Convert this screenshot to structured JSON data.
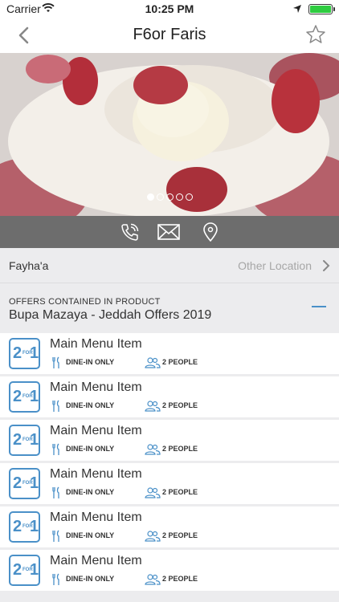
{
  "status_bar": {
    "carrier": "Carrier",
    "time": "10:25 PM"
  },
  "nav": {
    "title": "F6or Faris"
  },
  "carousel": {
    "count": 5,
    "active_index": 0
  },
  "location": {
    "branch": "Fayha'a",
    "other_label": "Other Location"
  },
  "offers": {
    "caption": "OFFERS CONTAINED IN PRODUCT",
    "group_name": "Bupa Mazaya - Jeddah Offers 2019",
    "items": [
      {
        "badge": "2for1",
        "title": "Main Menu Item",
        "dine": "DINE-IN ONLY",
        "people": "2 PEOPLE"
      },
      {
        "badge": "2for1",
        "title": "Main Menu Item",
        "dine": "DINE-IN ONLY",
        "people": "2 PEOPLE"
      },
      {
        "badge": "2for1",
        "title": "Main Menu Item",
        "dine": "DINE-IN ONLY",
        "people": "2 PEOPLE"
      },
      {
        "badge": "2for1",
        "title": "Main Menu Item",
        "dine": "DINE-IN ONLY",
        "people": "2 PEOPLE"
      },
      {
        "badge": "2for1",
        "title": "Main Menu Item",
        "dine": "DINE-IN ONLY",
        "people": "2 PEOPLE"
      },
      {
        "badge": "2for1",
        "title": "Main Menu Item",
        "dine": "DINE-IN ONLY",
        "people": "2 PEOPLE"
      }
    ]
  },
  "colors": {
    "accent": "#4a90c8",
    "action_bar": "#6d6d6d",
    "battery": "#2ecc40"
  },
  "icons": [
    "wifi-icon",
    "location-arrow-icon",
    "battery-icon",
    "back-chevron-icon",
    "star-outline-icon",
    "phone-icon",
    "mail-icon",
    "map-pin-icon",
    "chevron-right-icon",
    "fork-knife-icon",
    "people-icon"
  ]
}
